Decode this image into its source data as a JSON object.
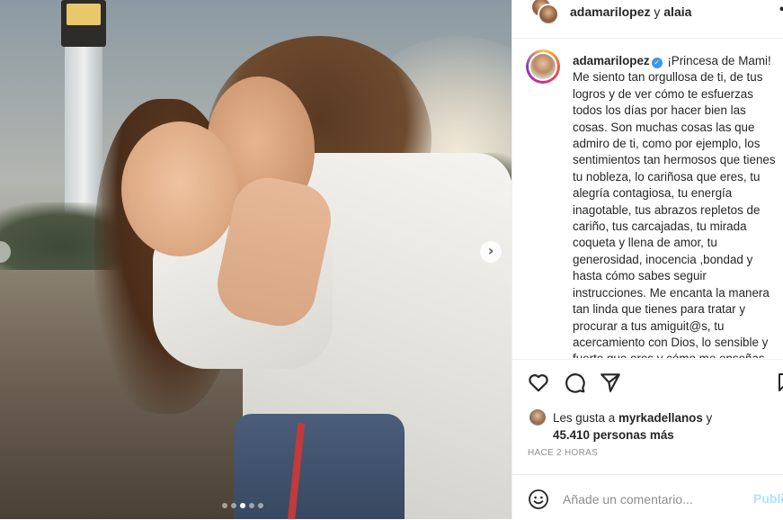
{
  "post": {
    "header_user": "adamarilopez",
    "header_joiner": "y",
    "header_coauthor": "alaia",
    "caption_user": "adamarilopez",
    "caption_text": "¡Princesa de Mami! Me siento tan orgullosa de ti, de tus logros y de ver cómo te esfuerzas todos los días por hacer bien las cosas. Son muchas cosas las que admiro de ti, como por ejemplo, los sentimientos tan hermosos que tienes tu nobleza, lo cariñosa que eres, tu alegría contagiosa, tu energía inagotable, tus abrazos repletos de cariño, tus carcajadas, tu mirada coqueta y llena de amor, tu generosidad, inocencia ,bondad y hasta cómo sabes seguir instrucciones. Me encanta la manera tan linda que tienes para tratar y procurar a tus amiguit@s, tu acercamiento con Dios, lo sensible y fuerte que eres y cómo me enseñas",
    "likes_prefix": "Les gusta a",
    "likes_user": "myrkadellanos",
    "likes_joiner": "y",
    "likes_count": "45.410 personas más",
    "timestamp": "Hace 2 horas"
  },
  "comment": {
    "placeholder": "Añade un comentario...",
    "publish_label": "Publicar"
  },
  "carousel": {
    "total_slides": 5,
    "active_index": 2
  },
  "icons": {
    "verified": "verified-badge-icon",
    "like": "heart-icon",
    "comment": "comment-bubble-icon",
    "share": "paper-plane-icon",
    "save": "bookmark-icon",
    "emoji": "smiley-icon",
    "next": "chevron-right-icon",
    "more": "more-dots-icon"
  },
  "colors": {
    "verified_blue": "#3897f0",
    "publish_disabled": "#b2dffc",
    "muted_text": "#8e8e8e"
  }
}
